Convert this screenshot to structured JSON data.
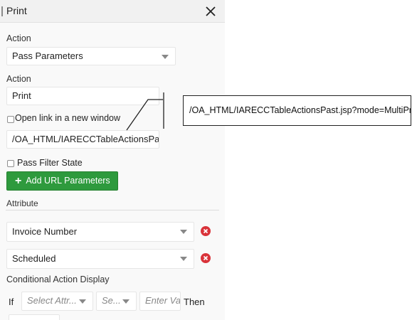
{
  "panel": {
    "title": "Print",
    "action_select": {
      "label": "Action",
      "value": "Pass Parameters"
    },
    "action_field": {
      "label": "Action",
      "value": "Print"
    },
    "open_new_window": {
      "label": "Open link in a new window",
      "checked": false
    },
    "url_field": {
      "value": "/OA_HTML/IARECCTableActionsPast.j"
    },
    "pass_filter_state": {
      "label": "Pass Filter State",
      "checked": false
    },
    "add_url_button": {
      "label": "Add URL Parameters"
    },
    "attribute": {
      "label": "Attribute",
      "rows": [
        {
          "value": "Invoice Number"
        },
        {
          "value": "Scheduled"
        }
      ]
    },
    "conditional": {
      "label": "Conditional Action Display",
      "if_label": "If",
      "select_attribute_placeholder": "Select Attr...",
      "operator_placeholder": "Se...",
      "value_placeholder": "Enter Val",
      "then_label": "Then"
    }
  },
  "callout": {
    "text": "/OA_HTML/IARECCTableActionsPast.jsp?mode=MultiPrint"
  },
  "colors": {
    "accent_green": "#2e9a3d",
    "remove_red": "#d9333a"
  }
}
